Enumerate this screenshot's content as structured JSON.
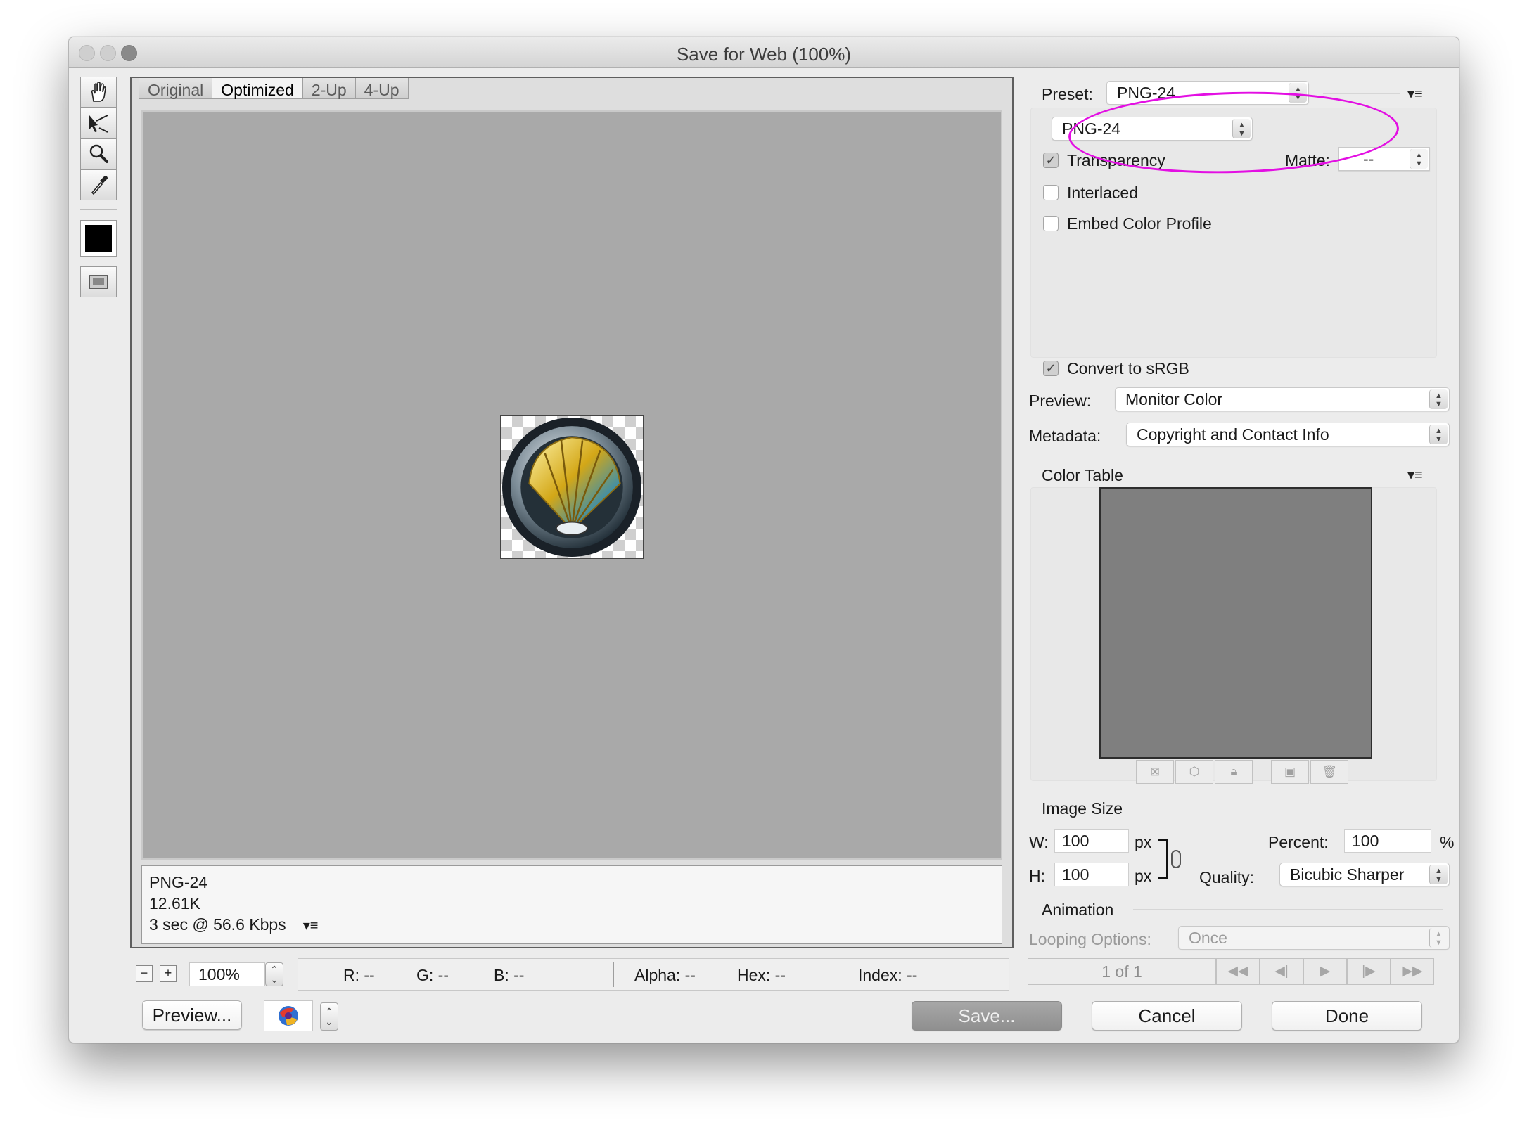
{
  "window": {
    "title": "Save for Web (100%)"
  },
  "tools": [
    {
      "name": "hand-icon"
    },
    {
      "name": "slice-select-icon"
    },
    {
      "name": "zoom-icon"
    },
    {
      "name": "eyedropper-icon"
    }
  ],
  "tabs": [
    {
      "label": "Original",
      "active": false
    },
    {
      "label": "Optimized",
      "active": true
    },
    {
      "label": "2-Up",
      "active": false
    },
    {
      "label": "4-Up",
      "active": false
    }
  ],
  "image_info": {
    "format": "PNG-24",
    "size": "12.61K",
    "download": "3 sec @ 56.6 Kbps"
  },
  "zoom": {
    "value": "100%"
  },
  "readout": {
    "r": "R: --",
    "g": "G: --",
    "b": "B: --",
    "alpha": "Alpha: --",
    "hex": "Hex: --",
    "index": "Index: --"
  },
  "buttons": {
    "preview": "Preview...",
    "save": "Save...",
    "cancel": "Cancel",
    "done": "Done"
  },
  "settings": {
    "preset_label": "Preset:",
    "preset_value": "PNG-24",
    "format_value": "PNG-24",
    "transparency": {
      "label": "Transparency",
      "checked": true
    },
    "matte_label": "Matte:",
    "matte_value": "--",
    "interlaced": {
      "label": "Interlaced",
      "checked": false
    },
    "embed_profile": {
      "label": "Embed Color Profile",
      "checked": false
    },
    "convert_srgb": {
      "label": "Convert to sRGB",
      "checked": true
    },
    "preview_label": "Preview:",
    "preview_value": "Monitor Color",
    "metadata_label": "Metadata:",
    "metadata_value": "Copyright and Contact Info"
  },
  "color_table": {
    "title": "Color Table"
  },
  "image_size": {
    "title": "Image Size",
    "w_label": "W:",
    "w_value": "100",
    "h_label": "H:",
    "h_value": "100",
    "unit": "px",
    "percent_label": "Percent:",
    "percent_value": "100",
    "percent_unit": "%",
    "quality_label": "Quality:",
    "quality_value": "Bicubic Sharper"
  },
  "animation": {
    "title": "Animation",
    "looping_label": "Looping Options:",
    "looping_value": "Once",
    "frame": "1 of 1"
  },
  "colors": {
    "annotation": "#e30fe3",
    "accent": "#2a6de4"
  }
}
